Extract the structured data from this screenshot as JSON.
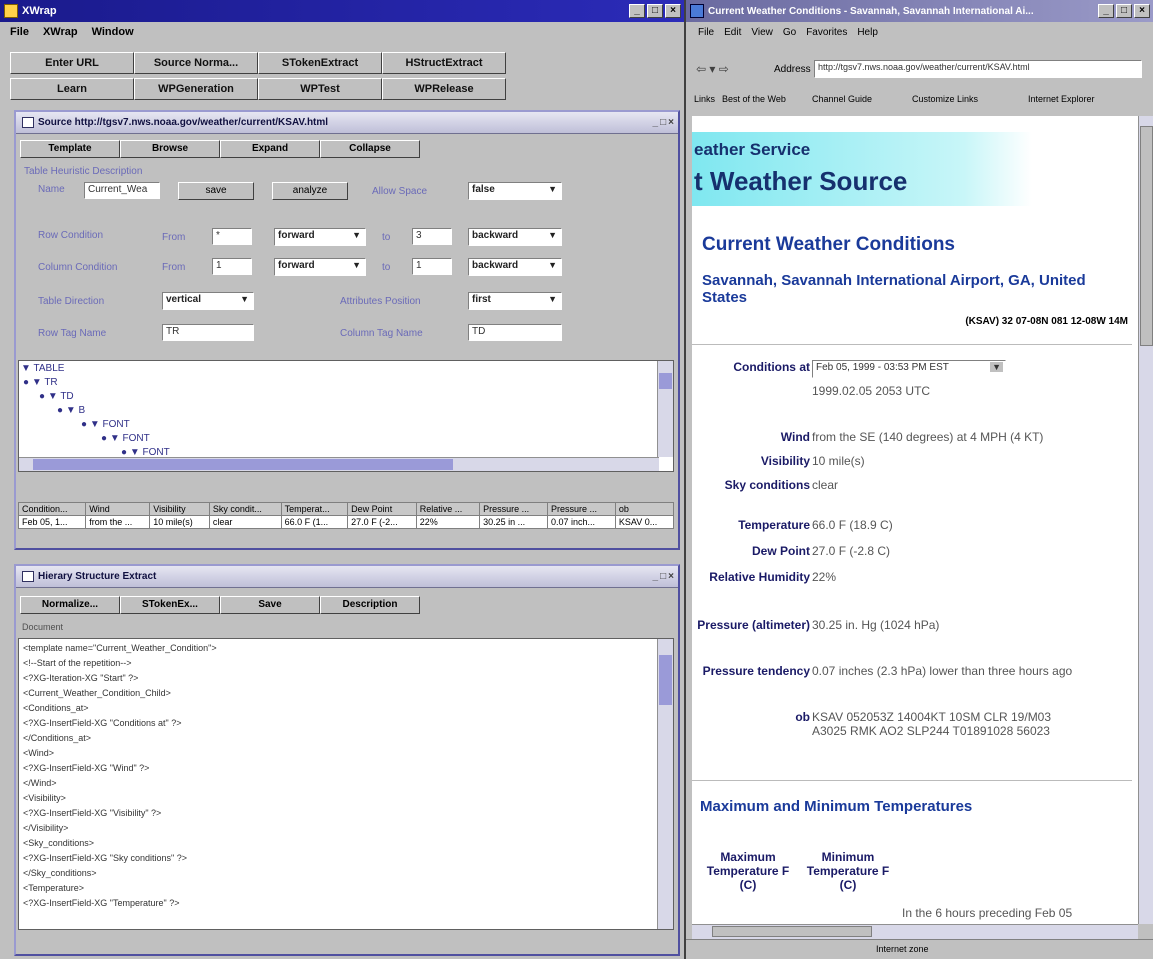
{
  "xwrap": {
    "title": "XWrap",
    "menu": [
      "File",
      "XWrap",
      "Window"
    ],
    "toolbar_row1": [
      "Enter URL",
      "Source Norma...",
      "STokenExtract",
      "HStructExtract"
    ],
    "toolbar_row2": [
      "Learn",
      "WPGeneration",
      "WPTest",
      "WPRelease"
    ],
    "source_panel": {
      "title": "Source http://tgsv7.nws.noaa.gov/weather/current/KSAV.html",
      "buttons": [
        "Template",
        "Browse",
        "Expand",
        "Collapse"
      ],
      "section_label": "Table Heuristic Description",
      "name_label": "Name",
      "name_value": "Current_Wea",
      "save_label": "save",
      "analyze_label": "analyze",
      "allow_space_label": "Allow Space",
      "allow_space_value": "false",
      "row_condition_label": "Row Condition",
      "column_condition_label": "Column Condition",
      "from_label": "From",
      "to_label": "to",
      "row_from": "*",
      "row_to": "3",
      "col_from": "1",
      "col_to": "1",
      "forward": "forward",
      "backward": "backward",
      "table_direction_label": "Table Direction",
      "table_direction_value": "vertical",
      "attributes_position_label": "Attributes Position",
      "attributes_position_value": "first",
      "row_tag_label": "Row Tag Name",
      "row_tag_value": "TR",
      "column_tag_label": "Column Tag Name",
      "column_tag_value": "TD"
    },
    "tree": [
      "TABLE",
      "TR",
      "TD",
      "B",
      "FONT",
      "FONT",
      "FONT"
    ],
    "table": {
      "headers": [
        "Condition...",
        "Wind",
        "Visibility",
        "Sky condit...",
        "Temperat...",
        "Dew Point",
        "Relative ...",
        "Pressure ...",
        "Pressure ...",
        "ob"
      ],
      "row": [
        "Feb 05, 1...",
        "from the ...",
        "10 mile(s)",
        "clear",
        "66.0 F (1...",
        "27.0 F (-2...",
        "22%",
        "30.25 in ...",
        "0.07 inch...",
        "KSAV 0..."
      ]
    },
    "hier_panel": {
      "title": "Hierary Structure Extract",
      "buttons": [
        "Normalize...",
        "STokenEx...",
        "Save",
        "Description"
      ],
      "tab": "Document",
      "code": [
        "<template name=\"Current_Weather_Condition\">",
        "<!--Start of the repetition-->",
        "<?XG-Iteration-XG \"Start\" ?>",
        "<Current_Weather_Condition_Child>",
        "<Conditions_at>",
        "<?XG-InsertField-XG \"Conditions at\" ?>",
        "</Conditions_at>",
        "<Wind>",
        "<?XG-InsertField-XG \"Wind\" ?>",
        "</Wind>",
        "<Visibility>",
        "<?XG-InsertField-XG \"Visibility\" ?>",
        "</Visibility>",
        "<Sky_conditions>",
        "<?XG-InsertField-XG \"Sky conditions\" ?>",
        "</Sky_conditions>",
        "<Temperature>",
        "<?XG-InsertField-XG \"Temperature\" ?>"
      ]
    }
  },
  "browser": {
    "title": "Current Weather Conditions - Savannah, Savannah International Ai...",
    "menu": [
      "File",
      "Edit",
      "View",
      "Go",
      "Favorites",
      "Help"
    ],
    "address_label": "Address",
    "address_value": "http://tgsv7.nws.noaa.gov/weather/current/KSAV.html",
    "links_label": "Links",
    "links": [
      "Best of the Web",
      "Channel Guide",
      "Customize Links",
      "Internet Explorer"
    ],
    "page": {
      "banner_small": "eather Service",
      "banner_large": "t Weather Source",
      "heading": "Current Weather Conditions",
      "location": "Savannah, Savannah International Airport, GA, United States",
      "coords": "(KSAV) 32 07-08N 081 12-08W 14M",
      "conditions_label": "Conditions at",
      "conditions_select": "Feb 05, 1999 - 03:53 PM EST",
      "utc": "1999.02.05 2053 UTC",
      "rows": [
        {
          "label": "Wind",
          "value": "from the SE (140 degrees) at 4 MPH (4 KT)"
        },
        {
          "label": "Visibility",
          "value": "10 mile(s)"
        },
        {
          "label": "Sky conditions",
          "value": "clear"
        },
        {
          "label": "Temperature",
          "value": "66.0 F (18.9 C)"
        },
        {
          "label": "Dew Point",
          "value": "27.0 F (-2.8 C)"
        },
        {
          "label": "Relative Humidity",
          "value": "22%"
        },
        {
          "label": "Pressure (altimeter)",
          "value": "30.25 in. Hg (1024 hPa)"
        },
        {
          "label": "Pressure tendency",
          "value": "0.07 inches (2.3 hPa) lower than three hours ago"
        },
        {
          "label": "ob",
          "value": "KSAV 052053Z 14004KT 10SM CLR 19/M03 A3025 RMK AO2 SLP244 T01891028 56023"
        }
      ],
      "minmax_heading": "Maximum and Minimum Temperatures",
      "max_label": "Maximum Temperature F (C)",
      "min_label": "Minimum Temperature F (C)",
      "footer_text": "In the 6 hours preceding Feb 05"
    },
    "status_zone": "Internet zone"
  }
}
